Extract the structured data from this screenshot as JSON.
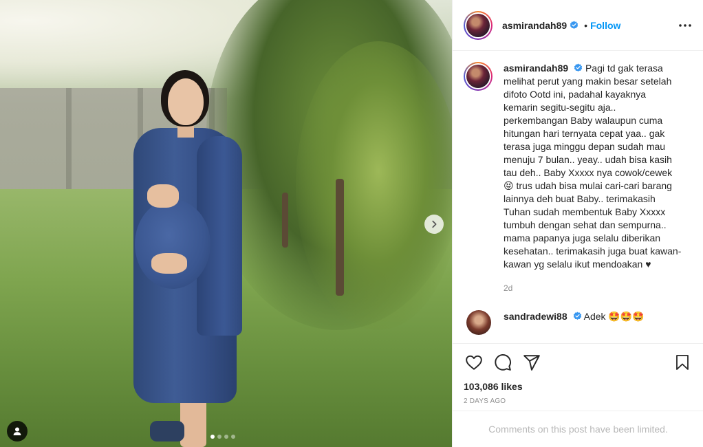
{
  "post": {
    "username": "asmirandah89",
    "follow_separator": "•",
    "follow_label": "Follow",
    "caption": "Pagi td gak terasa melihat perut yang makin besar setelah difoto Ootd ini, padahal kayaknya kemarin segitu-segitu aja.. perkembangan Baby walaupun cuma hitungan hari ternyata cepat yaa.. gak terasa juga minggu depan sudah mau menuju 7 bulan.. yeay.. udah bisa kasih tau deh.. Baby Xxxxx nya cowok/cewek 😝 trus udah bisa mulai cari-cari barang lainnya deh buat Baby.. terimakasih Tuhan sudah membentuk Baby Xxxxx tumbuh dengan sehat dan sempurna.. mama papanya juga selalu diberikan kesehatan.. terimakasih juga buat kawan-kawan yg selalu ikut mendoakan ♥",
    "caption_age": "2d",
    "likes": "103,086 likes",
    "date": "2 DAYS AGO",
    "comments_limited": "Comments on this post have been limited."
  },
  "reply": {
    "username": "sandradewi88",
    "text": "Adek 🤩🤩🤩"
  },
  "carousel": {
    "slides": 4,
    "active_index": 0
  },
  "icons": {
    "verified": "verified-badge-icon",
    "more": "more-options-icon",
    "like": "heart-icon",
    "comment": "comment-icon",
    "share": "send-icon",
    "save": "bookmark-icon",
    "next": "chevron-right-icon",
    "tags": "user-tag-icon"
  },
  "colors": {
    "link_blue": "#0095f6",
    "verified_blue": "#3897f0",
    "muted_text": "#8e8e8e",
    "limited_text": "#b8b8b8"
  }
}
